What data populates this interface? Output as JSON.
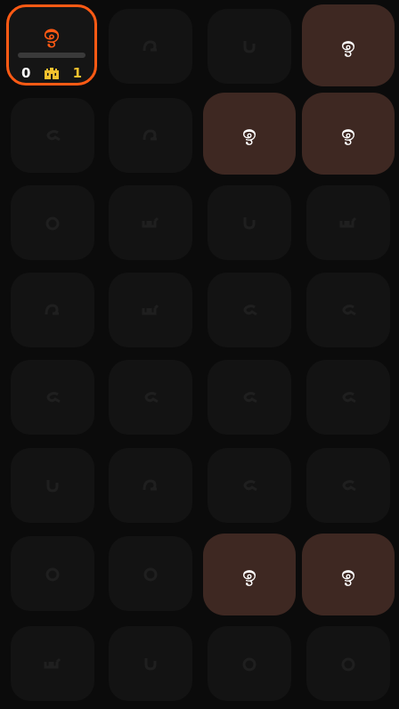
{
  "status": {
    "glyph": "ඉ",
    "left_value": "0",
    "right_value": "1",
    "progress": 0,
    "accent_color": "#ff5a14",
    "score_color": "#f2c12e",
    "icon": "castle-icon"
  },
  "tiles": [
    {
      "glyph": "ඉ",
      "lit": false
    },
    {
      "glyph": "ඉ",
      "lit": true
    },
    {
      "glyph": "ඉ",
      "lit": true
    },
    {
      "glyph": "ඉ",
      "lit": true
    },
    {
      "glyph": "ඉ",
      "lit": true
    },
    {
      "glyph": "ඉ",
      "lit": true
    }
  ],
  "colors": {
    "background": "#0b0b0b",
    "tile_dim": "#131313",
    "tile_lit": "#3e2822",
    "lit_glyph": "#ffffff"
  }
}
